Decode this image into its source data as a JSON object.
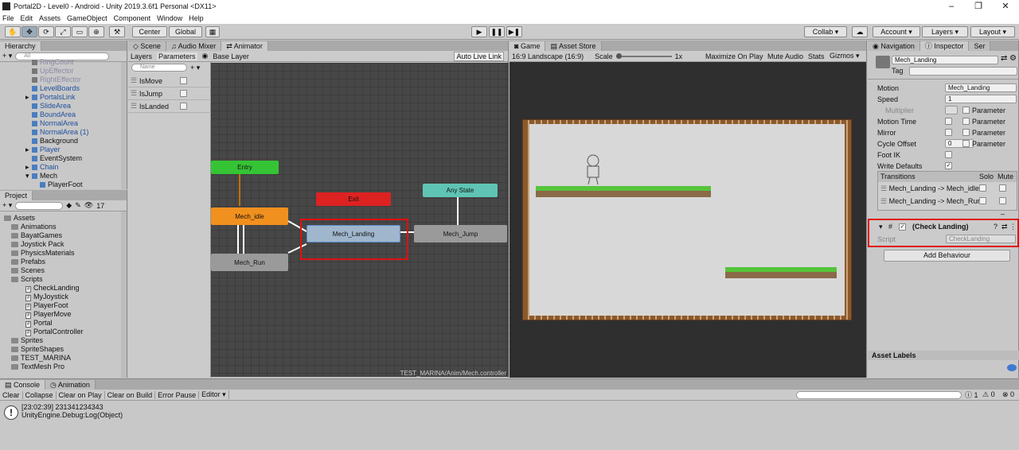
{
  "window": {
    "title": "Portal2D - Level0 - Android - Unity 2019.3.6f1 Personal <DX11>",
    "minimize": "–",
    "maximize": "❐",
    "close": "✕"
  },
  "menu": [
    "File",
    "Edit",
    "Assets",
    "GameObject",
    "Component",
    "Window",
    "Help"
  ],
  "toolbar": {
    "center": "Center",
    "global": "Global",
    "collab": "Collab ▾",
    "account": "Account ▾",
    "layers": "Layers ▾",
    "layout": "Layout ▾",
    "play": "▶",
    "pause": "❚❚",
    "step": "▶❚"
  },
  "hierarchy": {
    "tab": "Hierarchy",
    "search_placeholder": "All",
    "add": "+ ▾",
    "items": [
      {
        "label": "RingCount",
        "cls": "ghost"
      },
      {
        "label": "UpEffector",
        "cls": "ghost"
      },
      {
        "label": "RightEffector",
        "cls": "ghost"
      },
      {
        "label": "LevelBoards",
        "cls": "blue"
      },
      {
        "label": "PortalsLink",
        "cls": "blue"
      },
      {
        "label": "SlideArea",
        "cls": "blue"
      },
      {
        "label": "BoundArea",
        "cls": "blue"
      },
      {
        "label": "NormalArea",
        "cls": "blue"
      },
      {
        "label": "NormalArea (1)",
        "cls": "blue"
      },
      {
        "label": "Background",
        "cls": ""
      },
      {
        "label": "Player",
        "cls": "blue"
      },
      {
        "label": "EventSystem",
        "cls": ""
      },
      {
        "label": "Chain",
        "cls": "blue"
      },
      {
        "label": "Mech",
        "cls": ""
      },
      {
        "label": "PlayerFoot",
        "cls": ""
      }
    ]
  },
  "project": {
    "tab": "Project",
    "add": "+ ▾",
    "count": "17",
    "folders": [
      "Assets",
      "Animations",
      "BayatGames",
      "Joystick Pack",
      "PhysicsMaterials",
      "Prefabs",
      "Scenes",
      "Scripts"
    ],
    "scripts": [
      "CheckLanding",
      "MyJoystick",
      "PlayerFoot",
      "PlayerMove",
      "Portal",
      "PortalController"
    ],
    "folders2": [
      "Sprites",
      "SpriteShapes",
      "TEST_MARINA",
      "TextMesh Pro"
    ]
  },
  "animator": {
    "tabs": [
      "Scene",
      "Audio Mixer",
      "Animator"
    ],
    "layers_tab": "Layers",
    "params_tab": "Parameters",
    "base_layer": "Base Layer",
    "auto_live": "Auto Live Link",
    "search_placeholder": "Name",
    "add": "+ ▾",
    "parameters": [
      "IsMove",
      "IsJump",
      "IsLanded"
    ],
    "states": {
      "entry": "Entry",
      "exit": "Exit",
      "any": "Any State",
      "idle": "Mech_idle",
      "run": "Mech_Run",
      "landing": "Mech_Landing",
      "jump": "Mech_Jump"
    },
    "path": "TEST_MARINA/Anim/Mech.controller"
  },
  "game": {
    "tabs": [
      "Game",
      "Asset Store"
    ],
    "aspect": "16:9 Landscape (16:9)",
    "scale_label": "Scale",
    "scale_value": "1x",
    "maximize": "Maximize On Play",
    "mute": "Mute Audio",
    "stats": "Stats",
    "gizmos": "Gizmos ▾"
  },
  "inspector": {
    "tabs": [
      "Navigation",
      "Inspector",
      "Ser"
    ],
    "name": "Mech_Landing",
    "tag_label": "Tag",
    "rows": [
      {
        "label": "Motion",
        "value": "Mech_Landing"
      },
      {
        "label": "Speed",
        "value": "1"
      },
      {
        "label": "Multiplier",
        "value": ""
      },
      {
        "label": "Motion Time",
        "value": ""
      },
      {
        "label": "Mirror",
        "value": ""
      },
      {
        "label": "Cycle Offset",
        "value": "0"
      },
      {
        "label": "Foot IK",
        "value": ""
      },
      {
        "label": "Write Defaults",
        "value": "✓"
      }
    ],
    "parameter": "Parameter",
    "transitions_label": "Transitions",
    "solo": "Solo",
    "mute": "Mute",
    "transitions": [
      "Mech_Landing -> Mech_idle",
      "Mech_Landing -> Mech_Run"
    ],
    "component": "(Check Landing)",
    "script_label": "Script",
    "script_value": "CheckLanding",
    "add_behaviour": "Add Behaviour",
    "asset_labels": "Asset Labels"
  },
  "console": {
    "tabs": [
      "Console",
      "Animation"
    ],
    "buttons": [
      "Clear",
      "Collapse",
      "Clear on Play",
      "Clear on Build",
      "Error Pause",
      "Editor ▾"
    ],
    "counts": [
      "1",
      "0",
      "0"
    ],
    "log_line1": "[23:02:39] 231341234343",
    "log_line2": "UnityEngine.Debug:Log(Object)"
  }
}
